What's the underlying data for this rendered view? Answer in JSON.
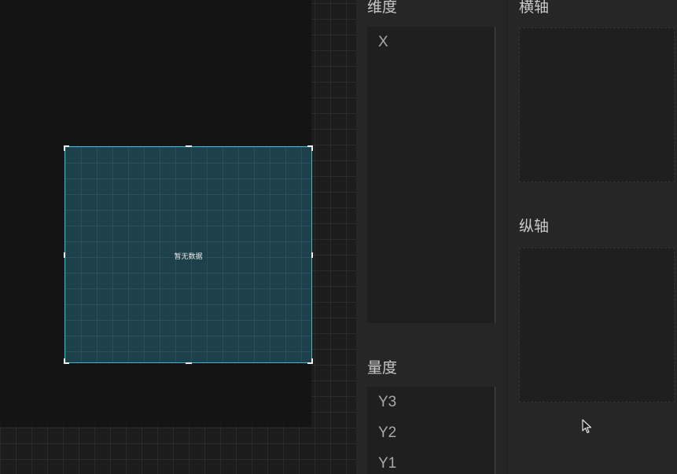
{
  "canvas": {
    "chart": {
      "empty_text": "暂无数据"
    }
  },
  "panels": {
    "dimension": {
      "title": "维度",
      "items": [
        "X"
      ]
    },
    "measure": {
      "title": "量度",
      "items": [
        "Y3",
        "Y2",
        "Y1"
      ]
    },
    "x_axis": {
      "title": "横轴"
    },
    "y_axis": {
      "title": "纵轴"
    }
  },
  "colors": {
    "accent": "#3ab8d8",
    "background": "#262626",
    "canvas": "#1c1c1c"
  }
}
